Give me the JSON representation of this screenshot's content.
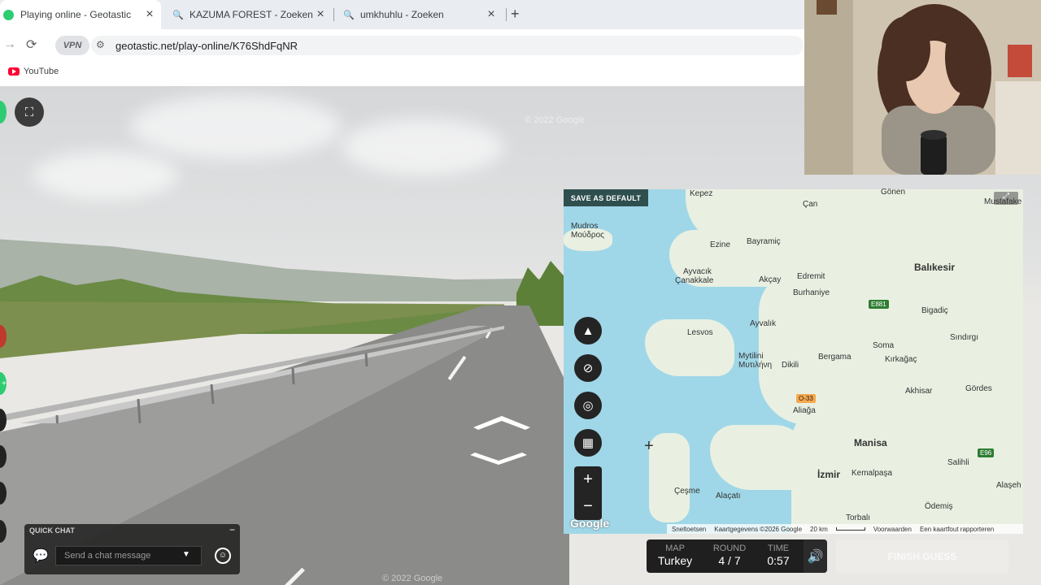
{
  "tabs": [
    {
      "label": "Playing online - Geotastic",
      "active": true
    },
    {
      "label": "KAZUMA FOREST - Zoeken"
    },
    {
      "label": "umkhuhlu - Zoeken"
    }
  ],
  "address": {
    "vpn": "VPN",
    "url": "geotastic.net/play-online/K76ShdFqNR"
  },
  "bookmarks": [
    {
      "label": "YouTube"
    }
  ],
  "scene": {
    "watermark": "© 2022 Google"
  },
  "map": {
    "save_default": "SAVE AS DEFAULT",
    "labels": {
      "kepez": "Kepez",
      "gonen": "Gönen",
      "mustafa": "Mustafake",
      "can": "Çan",
      "mudros": "Mudros",
      "mudros_gr": "Μούδρος",
      "ezine": "Ezine",
      "bayramic": "Bayramiç",
      "ayvacik": "Ayvacık",
      "canakkale": "Çanakkale",
      "akcay": "Akçay",
      "burhaniye": "Burhaniye",
      "edremit": "Edremit",
      "balikesir": "Balıkesir",
      "bigadic": "Bigadiç",
      "ayvalik": "Ayvalık",
      "lesvos": "Lesvos",
      "sindirgi": "Sındırgı",
      "mytilini": "Mytilini",
      "mytilini_gr": "Μυτιλήνη",
      "dikili": "Dikili",
      "bergama": "Bergama",
      "soma": "Soma",
      "kirkagac": "Kırkağaç",
      "akhisar": "Akhisar",
      "gordes": "Gördes",
      "aliaga": "Aliağa",
      "manisa": "Manisa",
      "salihli": "Salihli",
      "cesme": "Çeşme",
      "alacati": "Alaçatı",
      "izmir": "İzmir",
      "kemalpasa": "Kemalpaşa",
      "odemis": "Ödemiş",
      "alasehir": "Alaşeh",
      "torbali": "Torbalı"
    },
    "badges": {
      "e881": "E881",
      "o33": "O-33",
      "e96": "E96"
    },
    "footer": {
      "shortcuts": "Sneltoetsen",
      "data": "Kaartgegevens ©2026 Google",
      "scale": "20 km",
      "terms": "Voorwaarden",
      "report": "Een kaartfout rapporteren"
    },
    "logo": "Google"
  },
  "chat": {
    "title": "QUICK CHAT",
    "placeholder": "Send a chat message"
  },
  "status": {
    "map_label": "MAP",
    "map_value": "Turkey",
    "round_label": "ROUND",
    "round_value": "4 / 7",
    "time_label": "TIME",
    "time_value": "0:57"
  },
  "finish": "FINISH GUESS",
  "colors": {
    "accent_green": "#2ecc71",
    "map_water": "#9fd7e8",
    "map_land": "#e9f0e2",
    "dark_panel": "#1f1f1f"
  }
}
